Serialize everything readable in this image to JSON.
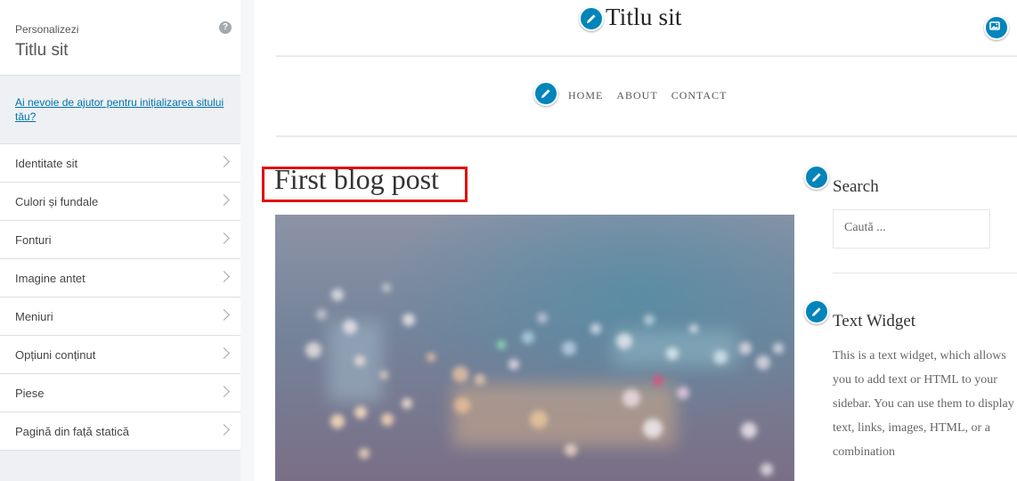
{
  "customizer": {
    "kicker": "Personalizezi",
    "site_title": "Titlu sit",
    "help_icon": "?",
    "help_link": "Ai nevoie de ajutor pentru inițializarea sitului tău?",
    "items": [
      {
        "label": "Identitate sit"
      },
      {
        "label": "Culori și fundale"
      },
      {
        "label": "Fonturi"
      },
      {
        "label": "Imagine antet"
      },
      {
        "label": "Meniuri"
      },
      {
        "label": "Opțiuni conținut"
      },
      {
        "label": "Piese"
      },
      {
        "label": "Pagină din față statică"
      }
    ]
  },
  "preview": {
    "site_title": "Titlu sit",
    "nav": [
      "HOME",
      "ABOUT",
      "CONTACT"
    ],
    "post_title": "First blog post",
    "search_widget": {
      "title": "Search",
      "placeholder": "Caută ..."
    },
    "text_widget": {
      "title": "Text Widget",
      "body": "This is a text widget, which allows you to add text or HTML to your sidebar. You can use them to display text, links, images, HTML, or a combination"
    }
  },
  "colors": {
    "accent": "#0085ba",
    "link": "#0073aa",
    "highlight": "#e01010"
  },
  "icons": {
    "edit": "pencil-icon",
    "header_image": "image-icon",
    "help": "question-circle-icon",
    "chevron": "chevron-right-icon"
  }
}
